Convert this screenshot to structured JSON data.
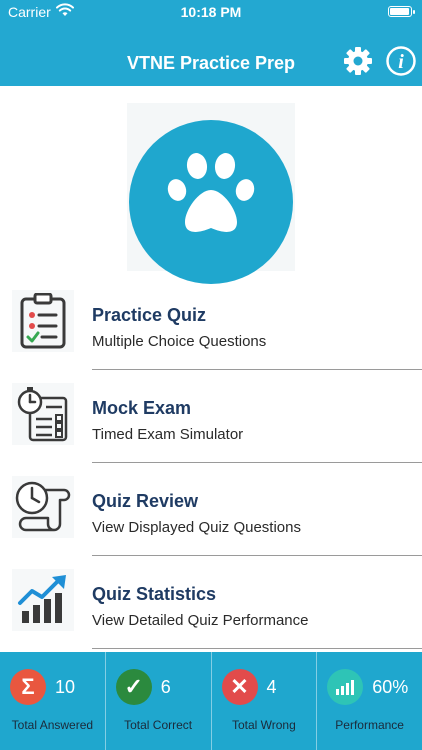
{
  "status_bar": {
    "carrier": "Carrier",
    "time": "10:18 PM"
  },
  "navbar": {
    "title": "VTNE Practice Prep",
    "settings_icon": "gear-icon",
    "info_icon": "info-icon",
    "color": "#23a8d1"
  },
  "hero": {
    "icon": "paw-icon",
    "color": "#1fa7ce"
  },
  "menu": {
    "items": [
      {
        "title": "Practice Quiz",
        "subtitle": "Multiple Choice Questions",
        "icon": "clipboard-checklist-icon"
      },
      {
        "title": "Mock Exam",
        "subtitle": "Timed Exam Simulator",
        "icon": "stopwatch-checklist-icon"
      },
      {
        "title": "Quiz Review",
        "subtitle": "View Displayed Quiz Questions",
        "icon": "clock-scroll-icon"
      },
      {
        "title": "Quiz Statistics",
        "subtitle": "View Detailed Quiz Performance",
        "icon": "growth-chart-icon"
      }
    ]
  },
  "stats": {
    "items": [
      {
        "value": "10",
        "label": "Total Answered",
        "badge_symbol": "Σ",
        "color": "#e9573f",
        "icon": "sigma-icon"
      },
      {
        "value": "6",
        "label": "Total Correct",
        "badge_symbol": "✓",
        "color": "#2b8a3e",
        "icon": "check-icon"
      },
      {
        "value": "4",
        "label": "Total Wrong",
        "badge_symbol": "✕",
        "color": "#e24b4b",
        "icon": "x-icon"
      },
      {
        "value": "60%",
        "label": "Performance",
        "badge_symbol": "",
        "color": "#2ec4b6",
        "icon": "bar-chart-icon"
      }
    ]
  }
}
